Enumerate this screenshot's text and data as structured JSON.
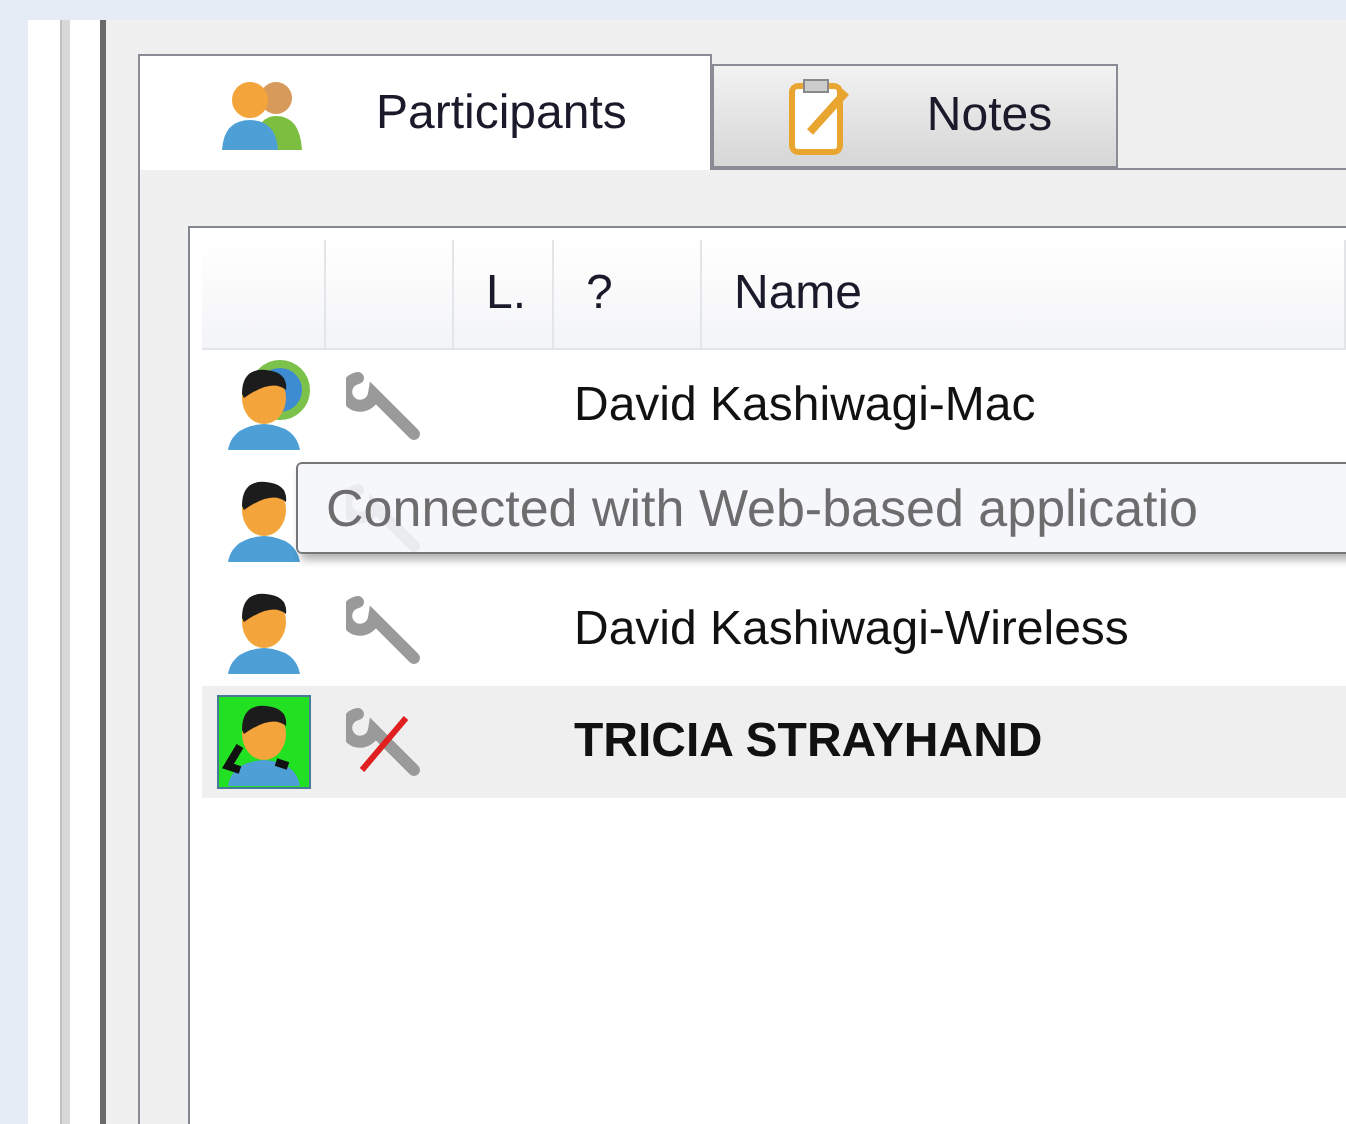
{
  "tabs": [
    {
      "label": "Participants",
      "kind": "people",
      "selected": true
    },
    {
      "label": "Notes",
      "kind": "notes",
      "selected": false
    }
  ],
  "list": {
    "columns": [
      "L.",
      "?",
      "Name"
    ],
    "rows": [
      {
        "kind": "web",
        "tool_disabled": false,
        "name": "David Kashiwagi-Mac",
        "selected": false
      },
      {
        "kind": "user",
        "tool_disabled": false,
        "selected": false
      },
      {
        "kind": "user",
        "tool_disabled": false,
        "name": "David Kashiwagi-Wireless",
        "selected": false
      },
      {
        "kind": "headset",
        "tool_disabled": true,
        "name": "TRICIA STRAYHAND",
        "selected": true
      }
    ]
  },
  "tooltip": {
    "text": "Connected with Web-based applicatio"
  }
}
